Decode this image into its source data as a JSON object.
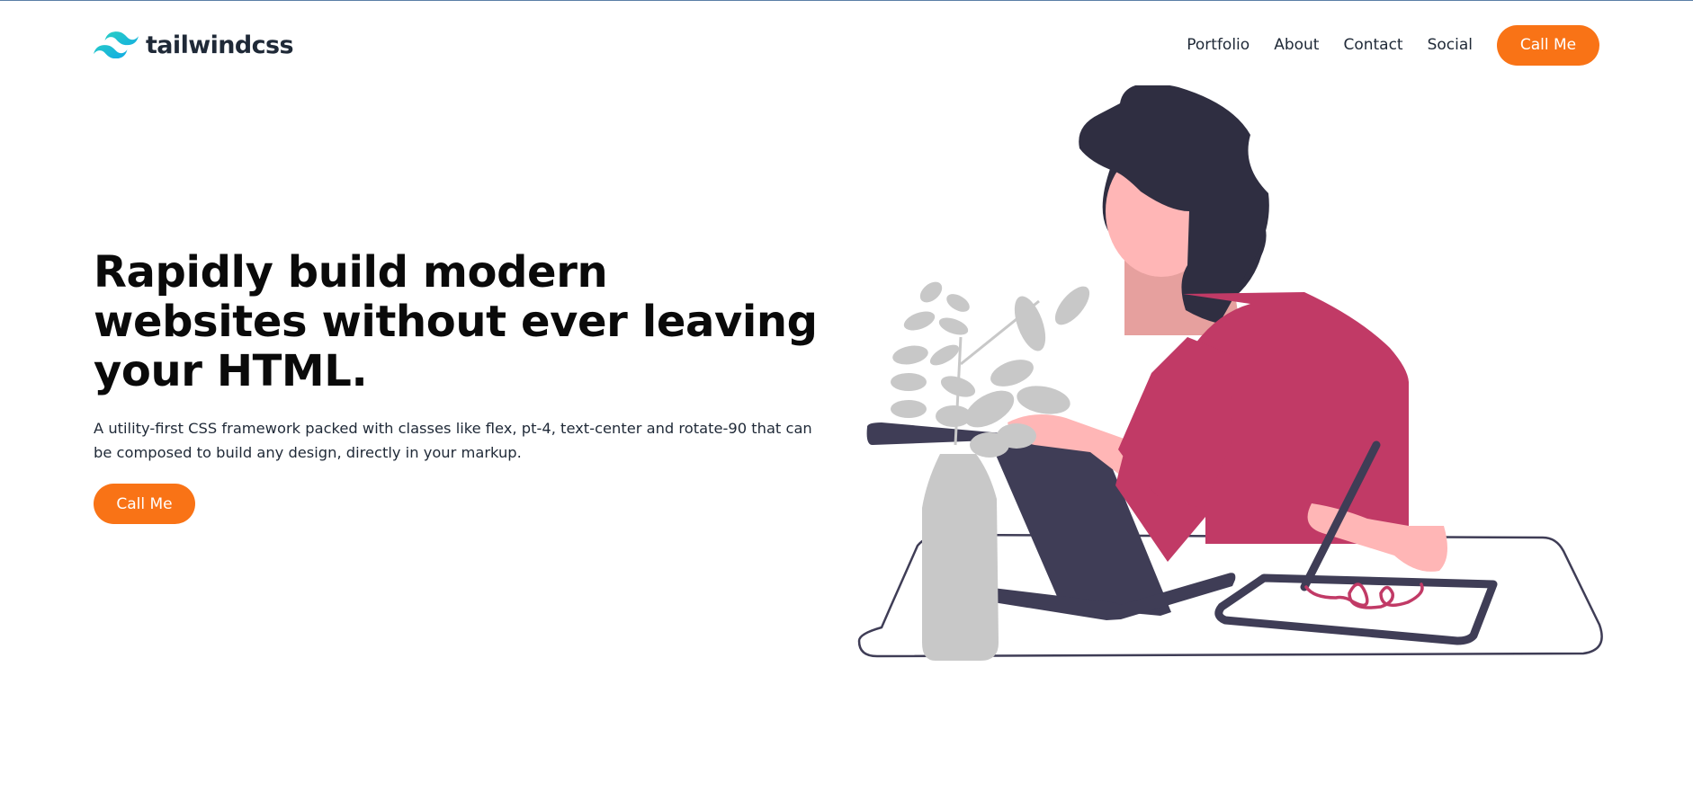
{
  "brand": {
    "name": "tailwindcss",
    "logo_icon": "tailwind-wave-icon",
    "logo_color": "#38bdf8"
  },
  "nav": {
    "links": [
      "Portfolio",
      "About",
      "Contact",
      "Social"
    ],
    "cta_label": "Call Me"
  },
  "hero": {
    "title": "Rapidly build modern websites without ever leaving your HTML.",
    "subtitle": "A utility-first CSS framework packed with classes like flex, pt-4, text-center and rotate-90 that can be composed to build any design, directly in your markup.",
    "cta_label": "Call Me"
  },
  "colors": {
    "accent": "#f97316",
    "text_dark": "#0a0a0a",
    "shirt": "#c13a66",
    "hair": "#2f2e41",
    "skin": "#ffb6b6",
    "plant": "#c8c8c8",
    "laptop": "#3f3d56"
  }
}
